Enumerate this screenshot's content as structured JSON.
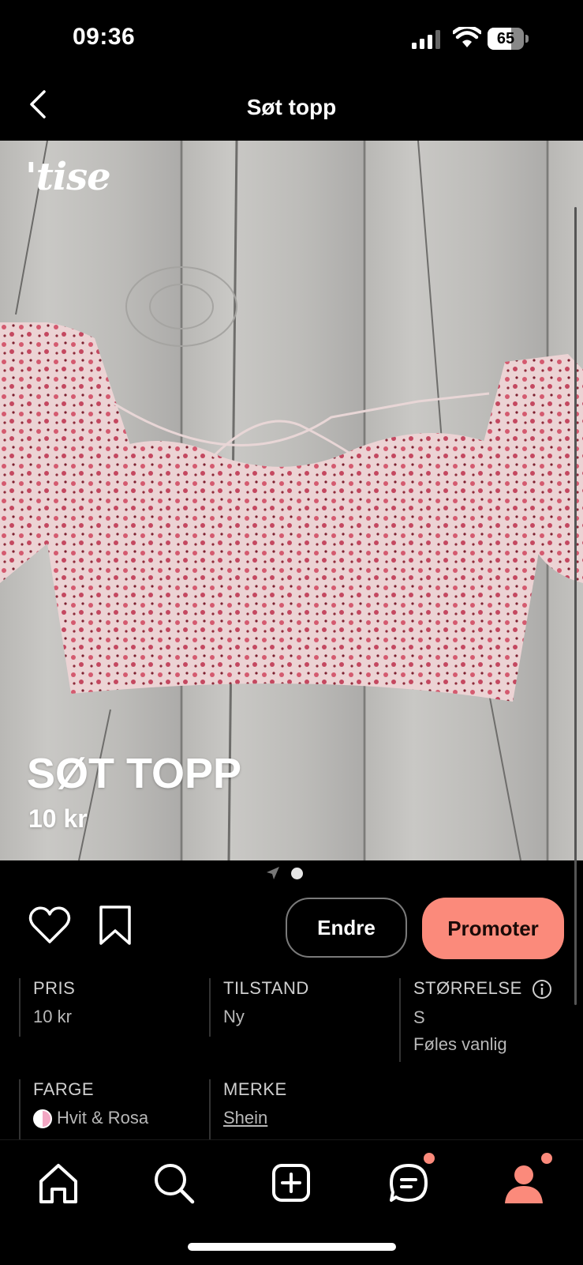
{
  "status_bar": {
    "time": "09:36",
    "battery_level": "65",
    "battery_fraction": 0.65
  },
  "header": {
    "title": "Søt topp"
  },
  "hero": {
    "logo": "'tise",
    "product_title": "SØT TOPP",
    "price": "10 kr",
    "image_count": 2,
    "active_image_index": 1
  },
  "actions": {
    "edit_label": "Endre",
    "promote_label": "Promoter",
    "promote_color": "#fb8a7b"
  },
  "details": {
    "price": {
      "label": "PRIS",
      "value": "10 kr"
    },
    "condition": {
      "label": "TILSTAND",
      "value": "Ny"
    },
    "size": {
      "label": "STØRRELSE",
      "value": "S",
      "fit": "Føles vanlig"
    },
    "color": {
      "label": "FARGE",
      "value": "Hvit & Rosa"
    },
    "brand": {
      "label": "MERKE",
      "value": "Shein"
    }
  },
  "tab_bar": {
    "items": [
      {
        "name": "home",
        "icon": "home-icon"
      },
      {
        "name": "search",
        "icon": "search-icon"
      },
      {
        "name": "add",
        "icon": "add-icon"
      },
      {
        "name": "messages",
        "icon": "chat-icon",
        "badge": true
      },
      {
        "name": "profile",
        "icon": "profile-icon",
        "badge": true,
        "active": true
      }
    ]
  }
}
